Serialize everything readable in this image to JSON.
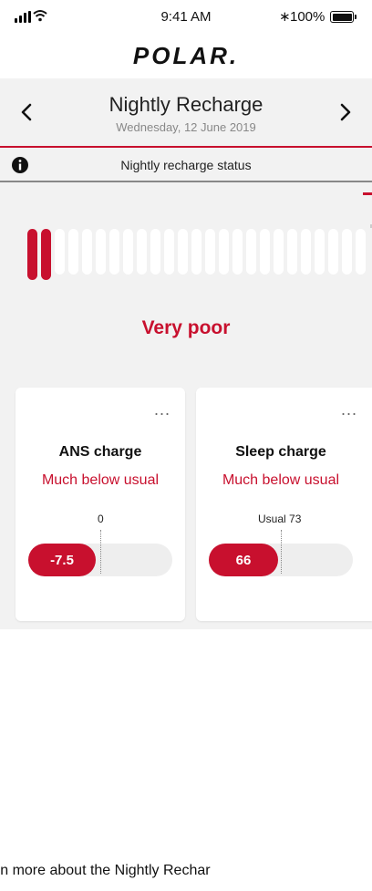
{
  "status_bar": {
    "time": "9:41 AM",
    "battery": "100%"
  },
  "logo": "POLAR.",
  "header": {
    "title": "Nightly Recharge",
    "date": "Wednesday, 12 June 2019"
  },
  "status": {
    "label": "Nightly recharge status",
    "level_text": "Very poor",
    "active_bars": 2,
    "total_bars": 25
  },
  "cards": [
    {
      "title": "ANS charge",
      "subtitle": "Much below usual",
      "ref_label": "0",
      "value": "-7.5",
      "menu": "..."
    },
    {
      "title": "Sleep charge",
      "subtitle": "Much below usual",
      "ref_label": "Usual 73",
      "value": "66",
      "menu": "..."
    }
  ],
  "footer": {
    "text": "arn more about the Nightly Rechar"
  },
  "colors": {
    "accent": "#c8102e",
    "background": "#f2f2f2"
  }
}
